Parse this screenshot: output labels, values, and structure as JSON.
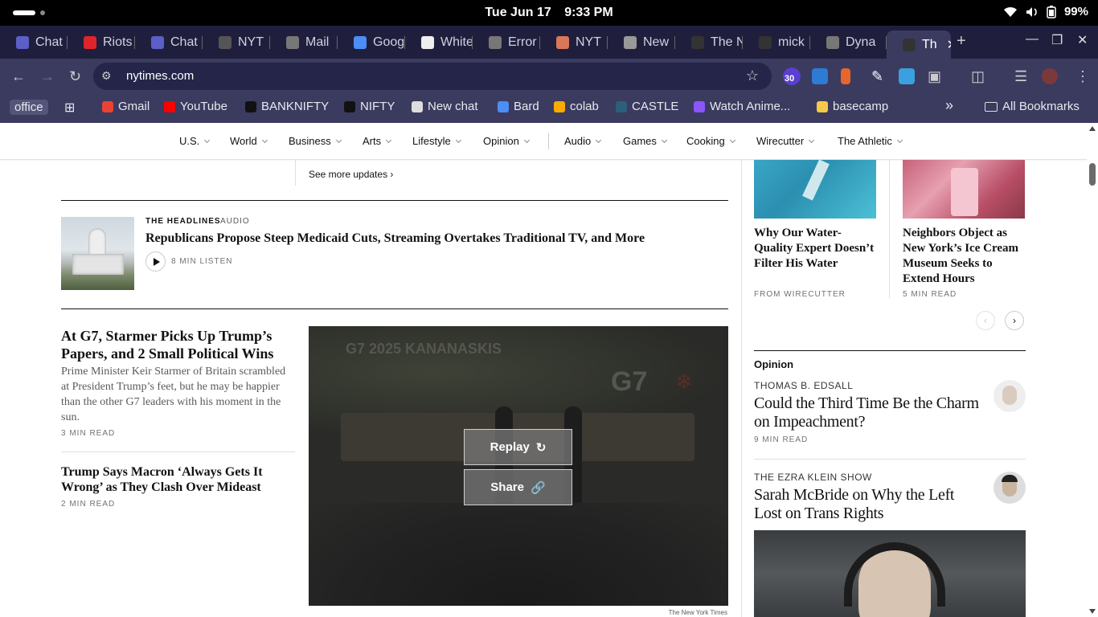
{
  "system": {
    "date": "Tue Jun 17",
    "time": "9:33 PM",
    "battery": "99%"
  },
  "tabs": [
    {
      "label": "Chat",
      "icon": "teams-icon",
      "color": "#5b5fc7"
    },
    {
      "label": "Riots",
      "icon": "j-icon",
      "color": "#e0242b"
    },
    {
      "label": "Chat",
      "icon": "teams-icon",
      "color": "#5b5fc7"
    },
    {
      "label": "NYT",
      "icon": "chatgpt-icon",
      "color": "#555"
    },
    {
      "label": "Mail",
      "icon": "globe-icon",
      "color": "#777"
    },
    {
      "label": "Goog",
      "icon": "gemini-icon",
      "color": "#4c8df6"
    },
    {
      "label": "White",
      "icon": "w-icon",
      "color": "#eee"
    },
    {
      "label": "Error",
      "icon": "globe-icon",
      "color": "#777"
    },
    {
      "label": "NYT",
      "icon": "claude-icon",
      "color": "#d97757"
    },
    {
      "label": "New",
      "icon": "chrome-icon",
      "color": "#999"
    },
    {
      "label": "The N",
      "icon": "nyt-icon",
      "color": "#333"
    },
    {
      "label": "mick",
      "icon": "github-icon",
      "color": "#333"
    },
    {
      "label": "Dyna",
      "icon": "globe-icon",
      "color": "#777"
    },
    {
      "label": "Th",
      "icon": "nyt-icon",
      "color": "#333"
    }
  ],
  "address": {
    "url": "nytimes.com"
  },
  "extensions": {
    "badge": "30"
  },
  "bookmarks": [
    {
      "label": "office",
      "icon": "folder-label"
    },
    {
      "label": "Gmail",
      "icon": "gmail-icon",
      "color": "#ea4335"
    },
    {
      "label": "YouTube",
      "icon": "youtube-icon",
      "color": "#ff0000"
    },
    {
      "label": "BANKNIFTY",
      "icon": "tradingview-icon",
      "color": "#111"
    },
    {
      "label": "NIFTY",
      "icon": "tradingview-icon",
      "color": "#111"
    },
    {
      "label": "New chat",
      "icon": "chatgpt-icon",
      "color": "#ddd"
    },
    {
      "label": "Bard",
      "icon": "gemini-icon",
      "color": "#4c8df6"
    },
    {
      "label": "colab",
      "icon": "colab-icon",
      "color": "#f9ab00"
    },
    {
      "label": "CASTLE",
      "icon": "castle-icon",
      "color": "#2c5f7a"
    },
    {
      "label": "Watch Anime...",
      "icon": "hianime-icon",
      "color": "#8a56ff"
    },
    {
      "label": "basecamp",
      "icon": "basecamp-icon",
      "color": "#f7c948"
    }
  ],
  "all_bookmarks": "All Bookmarks",
  "nav": [
    "U.S.",
    "World",
    "Business",
    "Arts",
    "Lifestyle",
    "Opinion",
    "Audio",
    "Games",
    "Cooking",
    "Wirecutter",
    "The Athletic"
  ],
  "updates": {
    "link": "See more updates ›"
  },
  "headlines_audio": {
    "kicker": "THE HEADLINES",
    "tag": "AUDIO",
    "title": "Republicans Propose Steep Medicaid Cuts, Streaming Overtakes Traditional TV, and More",
    "duration": "8 MIN LISTEN"
  },
  "stories": [
    {
      "title": "At G7, Starmer Picks Up Trump’s Papers, and 2 Small Political Wins",
      "summary": "Prime Minister Keir Starmer of Britain scrambled at President Trump’s feet, but he may be happier than the other G7 leaders with his moment in the sun.",
      "meta": "3 MIN READ"
    },
    {
      "title": "Trump Says Macron ‘Always Gets It Wrong’ as They Clash Over Mideast",
      "meta": "2 MIN READ"
    }
  ],
  "video": {
    "sign_left": "G7 2025 KANANASKIS",
    "sign_right": "G7",
    "replay": "Replay",
    "share": "Share",
    "credit": "The New York Times"
  },
  "cards": [
    {
      "title": "Why Our Water-Quality Expert Doesn’t Filter His Water",
      "meta": "FROM WIRECUTTER"
    },
    {
      "title": "Neighbors Object as New York’s Ice Cream Museum Seeks to Extend Hours",
      "meta": "5 MIN READ"
    }
  ],
  "opinion": {
    "label": "Opinion",
    "items": [
      {
        "author": "THOMAS B. EDSALL",
        "title": "Could the Third Time Be the Charm on Impeachment?",
        "meta": "9 MIN READ"
      },
      {
        "author": "THE EZRA KLEIN SHOW",
        "title": "Sarah McBride on Why the Left Lost on Trans Rights"
      }
    ]
  }
}
